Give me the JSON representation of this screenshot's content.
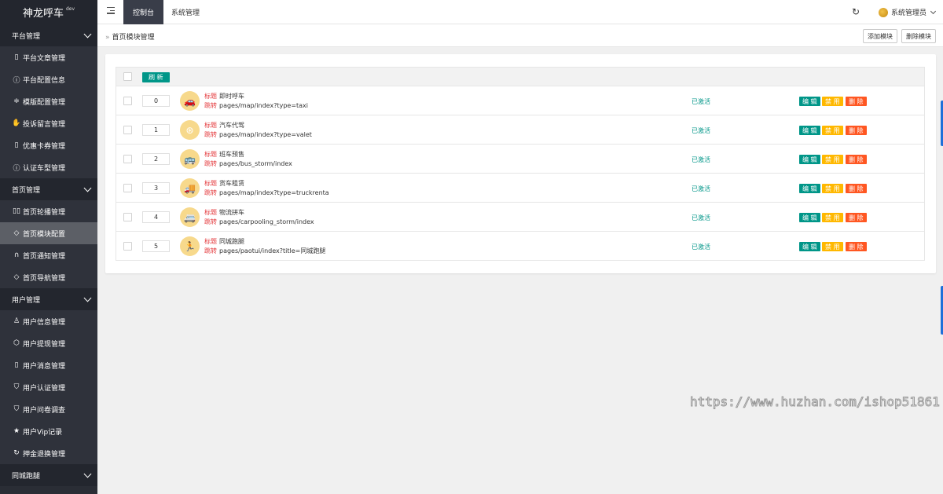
{
  "brand": {
    "title": "神龙呼车",
    "badge": "dev"
  },
  "sidebar": {
    "groups": [
      {
        "label": "平台管理",
        "items": [
          {
            "icon": "document-icon",
            "glyph": "▯",
            "label": "平台文章管理"
          },
          {
            "icon": "info-icon",
            "glyph": "ⓘ",
            "label": "平台配置信息"
          },
          {
            "icon": "sliders-icon",
            "glyph": "≑",
            "label": "模版配置管理"
          },
          {
            "icon": "hand-icon",
            "glyph": "✋",
            "label": "投诉留言管理"
          },
          {
            "icon": "document-icon",
            "glyph": "▯",
            "label": "优惠卡券管理"
          },
          {
            "icon": "info-icon",
            "glyph": "ⓘ",
            "label": "认证车型管理"
          }
        ]
      },
      {
        "label": "首页管理",
        "items": [
          {
            "icon": "carousel-icon",
            "glyph": "▯▯",
            "label": "首页轮播管理"
          },
          {
            "icon": "tag-icon",
            "glyph": "◇",
            "label": "首页模块配置",
            "active": true
          },
          {
            "icon": "headset-icon",
            "glyph": "∩",
            "label": "首页通知管理"
          },
          {
            "icon": "tag-icon",
            "glyph": "◇",
            "label": "首页导航管理"
          }
        ]
      },
      {
        "label": "用户管理",
        "items": [
          {
            "icon": "user-icon",
            "glyph": "♙",
            "label": "用户信息管理"
          },
          {
            "icon": "cube-icon",
            "glyph": "⬡",
            "label": "用户提现管理"
          },
          {
            "icon": "document-icon",
            "glyph": "▯",
            "label": "用户消息管理"
          },
          {
            "icon": "shield-icon",
            "glyph": "⛉",
            "label": "用户认证管理"
          },
          {
            "icon": "shield-icon",
            "glyph": "⛉",
            "label": "用户问卷调查"
          },
          {
            "icon": "star-icon",
            "glyph": "★",
            "label": "用户Vip记录"
          },
          {
            "icon": "refresh-icon",
            "glyph": "↻",
            "label": "押金退换管理"
          }
        ]
      },
      {
        "label": "同城跑腿",
        "items": []
      }
    ]
  },
  "topbar": {
    "tabs": [
      "控制台",
      "系统管理"
    ],
    "refresh_glyph": "↻",
    "user": "系统管理员"
  },
  "breadcrumb": {
    "sep": "»",
    "current": "首页模块管理"
  },
  "actions": {
    "add": "添加模块",
    "delete": "删除模块"
  },
  "table": {
    "refresh_label": "刷 新",
    "title_label": "标题",
    "link_label": "跳转",
    "status_label": "已激活",
    "edit_label": "编 辑",
    "disable_label": "禁 用",
    "delete_label": "删 除",
    "rows": [
      {
        "sort": "0",
        "icon": "taxi-icon",
        "glyph": "🚗",
        "title": "即时呼车",
        "link": "pages/map/index?type=taxi"
      },
      {
        "sort": "1",
        "icon": "steering-wheel-icon",
        "glyph": "⊛",
        "title": "汽车代驾",
        "link": "pages/map/index?type=valet"
      },
      {
        "sort": "2",
        "icon": "bus-icon",
        "glyph": "🚌",
        "title": "班车预售",
        "link": "pages/bus_storm/index"
      },
      {
        "sort": "3",
        "icon": "truck-icon",
        "glyph": "🚚",
        "title": "货车租赁",
        "link": "pages/map/index?type=truckrenta"
      },
      {
        "sort": "4",
        "icon": "van-icon",
        "glyph": "🚐",
        "title": "物流拼车",
        "link": "pages/carpooling_storm/index"
      },
      {
        "sort": "5",
        "icon": "runner-icon",
        "glyph": "🏃",
        "title": "同城跑腿",
        "link": "pages/paotui/index?title=同城跑腿"
      }
    ]
  },
  "watermark": "https://www.huzhan.com/ishop51861",
  "colors": {
    "accent": "#009688",
    "warn": "#ffb800",
    "danger": "#ff5722",
    "sidebar": "#2a2d35"
  }
}
